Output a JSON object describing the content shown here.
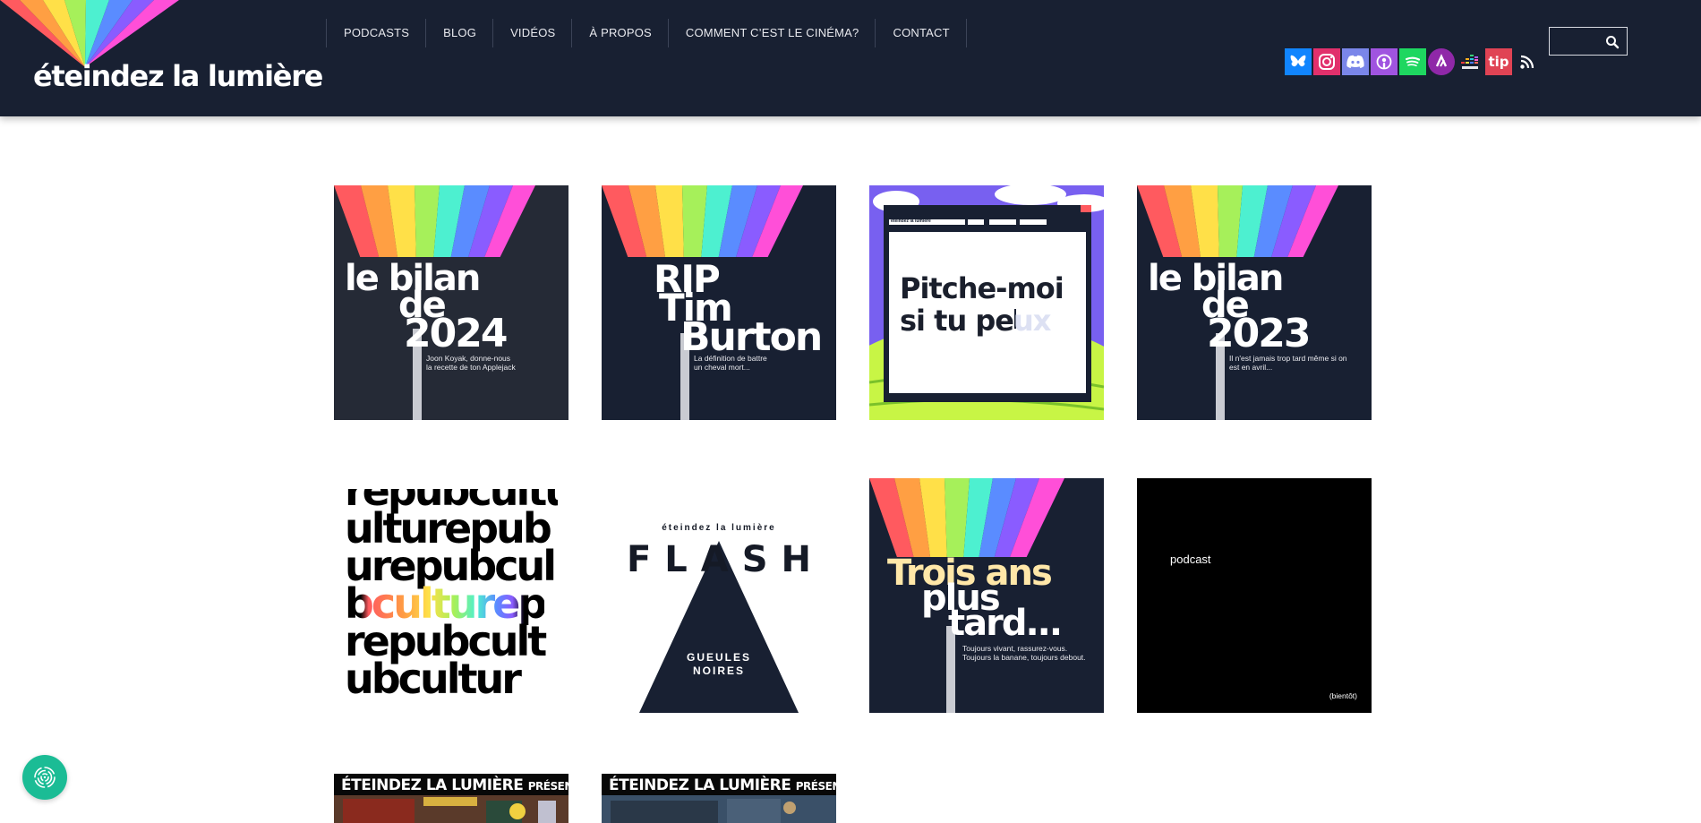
{
  "header": {
    "logo_text": "éteindez la lumière",
    "nav": [
      "PODCASTS",
      "BLOG",
      "VIDÉOS",
      "À PROPOS",
      "COMMENT C’EST LE CINÉMA?",
      "CONTACT"
    ],
    "socials": [
      {
        "name": "bluesky-icon",
        "color": "#1185fe"
      },
      {
        "name": "instagram-icon",
        "color": "#e1306c"
      },
      {
        "name": "discord-icon",
        "color": "#7a86e9"
      },
      {
        "name": "apple-podcasts-icon",
        "color": "#a054e0"
      },
      {
        "name": "spotify-icon",
        "color": "#1ed760"
      },
      {
        "name": "podcast-addict-icon",
        "color": "#8f28a8"
      },
      {
        "name": "deezer-icon",
        "color": "#182032"
      },
      {
        "name": "tipeee-icon",
        "color": "#e04354",
        "label": "tip"
      },
      {
        "name": "rss-icon",
        "color": "#ffffff"
      }
    ],
    "search": {
      "placeholder": "",
      "value": ""
    }
  },
  "tiles": [
    {
      "id": "bilan-2024",
      "title_lines": [
        "le bilan",
        "de",
        "2024"
      ],
      "subtitle_lines": [
        "Joon Koyak, donne-nous",
        "la recette de ton Applejack"
      ]
    },
    {
      "id": "rip-tim-burton",
      "title_lines": [
        "RIP",
        "Tim",
        "Burton"
      ],
      "subtitle_lines": [
        "La définition de battre",
        "un cheval mort..."
      ]
    },
    {
      "id": "pitche-moi",
      "title_lines": [
        "Pitche-moi",
        "si tu pe",
        "ux"
      ],
      "toolbar": "éteindez la lumière"
    },
    {
      "id": "bilan-2023",
      "title_lines": [
        "le bilan",
        "de",
        "2023"
      ],
      "subtitle_lines": [
        "Il n'est jamais trop tard même si on",
        "est en avril..."
      ]
    },
    {
      "id": "republiculture",
      "lines": [
        "repubcultu",
        "ulturepub",
        "urepubcul",
        "bculturep",
        "repubcult",
        "ubcultur"
      ]
    },
    {
      "id": "flash",
      "top": "éteindez la lumière",
      "word": "FLASH",
      "sub_lines": [
        "GUEULES",
        "NOIRES"
      ]
    },
    {
      "id": "trois-ans-plus-tard",
      "title_lines": [
        "Trois ans",
        "plus",
        "tard..."
      ],
      "subtitle_lines": [
        "Toujours vivant, rassurez-vous.",
        "Toujours la banane, toujours debout."
      ]
    },
    {
      "id": "podcast-bientot",
      "label": "podcast",
      "soon": "(bientôt)"
    },
    {
      "id": "presente-1",
      "banner": "ÉTEINDEZ LA LUMIÈRE",
      "banner_small": "PRÉSENTE"
    },
    {
      "id": "presente-2",
      "banner": "ÉTEINDEZ LA LUMIÈRE",
      "banner_small": "PRÉSENTE"
    }
  ],
  "rainbow": [
    "#ff5a5f",
    "#ff9f43",
    "#ffe048",
    "#a6f05a",
    "#4df0d0",
    "#5a8cff",
    "#8a5cff",
    "#ff4fd8"
  ]
}
